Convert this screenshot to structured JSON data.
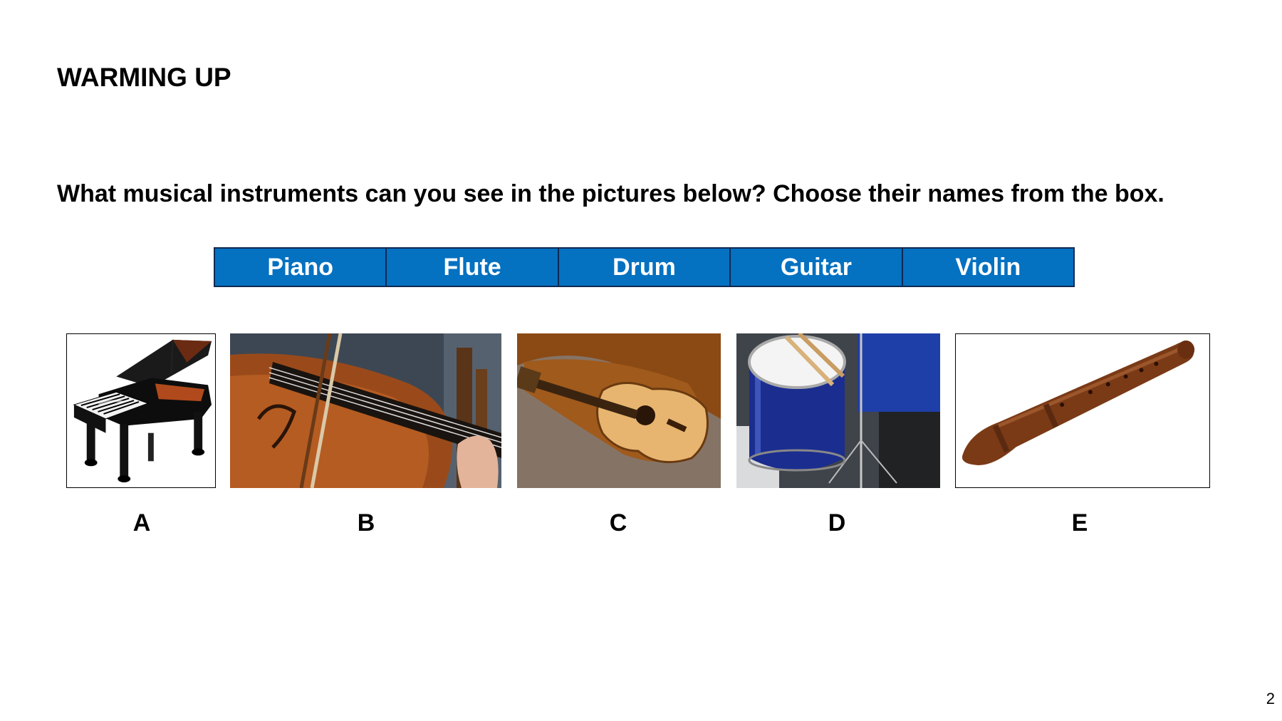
{
  "title": "WARMING UP",
  "question": "What musical instruments can you see in the pictures below? Choose their names from the box.",
  "word_box": [
    "Piano",
    "Flute",
    "Drum",
    "Guitar",
    "Violin"
  ],
  "pictures": [
    {
      "letter": "A",
      "icon": "piano-image"
    },
    {
      "letter": "B",
      "icon": "violin-image"
    },
    {
      "letter": "C",
      "icon": "guitar-image"
    },
    {
      "letter": "D",
      "icon": "drum-image"
    },
    {
      "letter": "E",
      "icon": "flute-image"
    }
  ],
  "page_number": "2",
  "colors": {
    "box_fill": "#0571c1",
    "box_border": "#0f2a52",
    "box_text": "#ffffff"
  }
}
